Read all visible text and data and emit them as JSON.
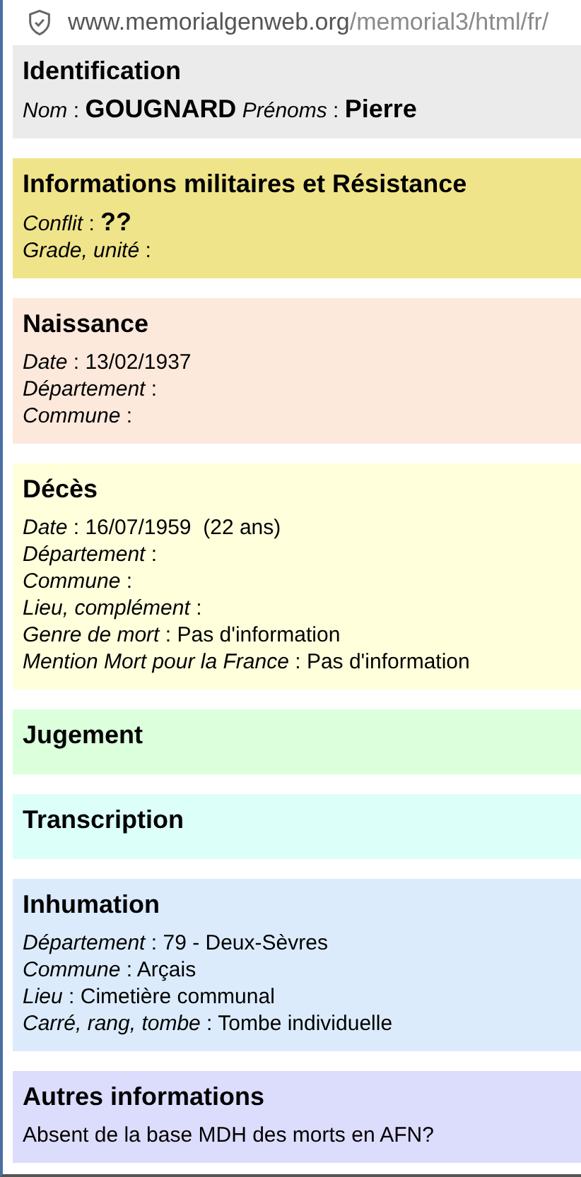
{
  "address_bar": {
    "domain": "www.memorialgenweb.org",
    "path": "/memorial3/html/fr/"
  },
  "sections": [
    {
      "title": "Identification",
      "color": "#ebebeb",
      "rows": [
        {
          "kind": "fields",
          "fields": [
            {
              "label": "*Nom* :",
              "value": "GOUGNARD",
              "emphasis": true
            },
            {
              "label": "*Prénoms* :",
              "value": "Pierre",
              "emphasis": true
            }
          ]
        }
      ]
    },
    {
      "title": "Informations militaires et Résistance",
      "color": "#f0e48a",
      "rows": [
        {
          "kind": "fields",
          "fields": [
            {
              "label": "*Conflit* :",
              "value": "??",
              "emphasis": true
            }
          ]
        },
        {
          "kind": "fields",
          "fields": [
            {
              "label": "*Grade, unité* :"
            }
          ]
        }
      ]
    },
    {
      "title": "Naissance",
      "color": "#fde8dc",
      "rows": [
        {
          "kind": "fields",
          "fields": [
            {
              "label": "*Date* :",
              "value": "13/02/1937",
              "emphasis": false
            }
          ]
        },
        {
          "kind": "fields",
          "fields": [
            {
              "label": "*Département* :"
            }
          ]
        },
        {
          "kind": "fields",
          "fields": [
            {
              "label": "*Commune* :"
            }
          ]
        }
      ]
    },
    {
      "title": "Décès",
      "color": "#ffffdc",
      "rows": [
        {
          "kind": "fields",
          "fields": [
            {
              "label": "*Date* :",
              "value": "16/07/1959  (22 ans)",
              "emphasis": false
            }
          ]
        },
        {
          "kind": "fields",
          "fields": [
            {
              "label": "*Département* :"
            }
          ]
        },
        {
          "kind": "fields",
          "fields": [
            {
              "label": "*Commune* :"
            }
          ]
        },
        {
          "kind": "fields",
          "fields": [
            {
              "label": "*Lieu, complément* :"
            }
          ]
        },
        {
          "kind": "fields",
          "fields": [
            {
              "label": "*Genre de mort* :",
              "value": "Pas d'information",
              "emphasis": false
            }
          ]
        },
        {
          "kind": "fields",
          "fields": [
            {
              "label": "*Mention Mort pour la France* :",
              "value": "Pas d'information",
              "emphasis": false
            }
          ]
        }
      ]
    },
    {
      "title": "Jugement",
      "color": "#dcffdc"
    },
    {
      "title": "Transcription",
      "color": "#dcfffa"
    },
    {
      "title": "Inhumation",
      "color": "#dcebfc",
      "rows": [
        {
          "kind": "fields",
          "fields": [
            {
              "label": "*Département* :",
              "value": "79 - Deux-Sèvres",
              "emphasis": false
            }
          ]
        },
        {
          "kind": "fields",
          "fields": [
            {
              "label": "*Commune* :",
              "value": "Arçais",
              "emphasis": false
            }
          ]
        },
        {
          "kind": "fields",
          "fields": [
            {
              "label": "*Lieu* :",
              "value": "Cimetière communal",
              "emphasis": false
            }
          ]
        },
        {
          "kind": "fields",
          "fields": [
            {
              "label": "*Carré, rang, tombe* :",
              "value": "Tombe individuelle",
              "emphasis": false
            }
          ]
        }
      ]
    },
    {
      "title": "Autres informations",
      "color": "#dcdcfc",
      "rows": [
        {
          "kind": "text",
          "text": "Absent de la base MDH des morts en AFN?"
        }
      ]
    }
  ]
}
